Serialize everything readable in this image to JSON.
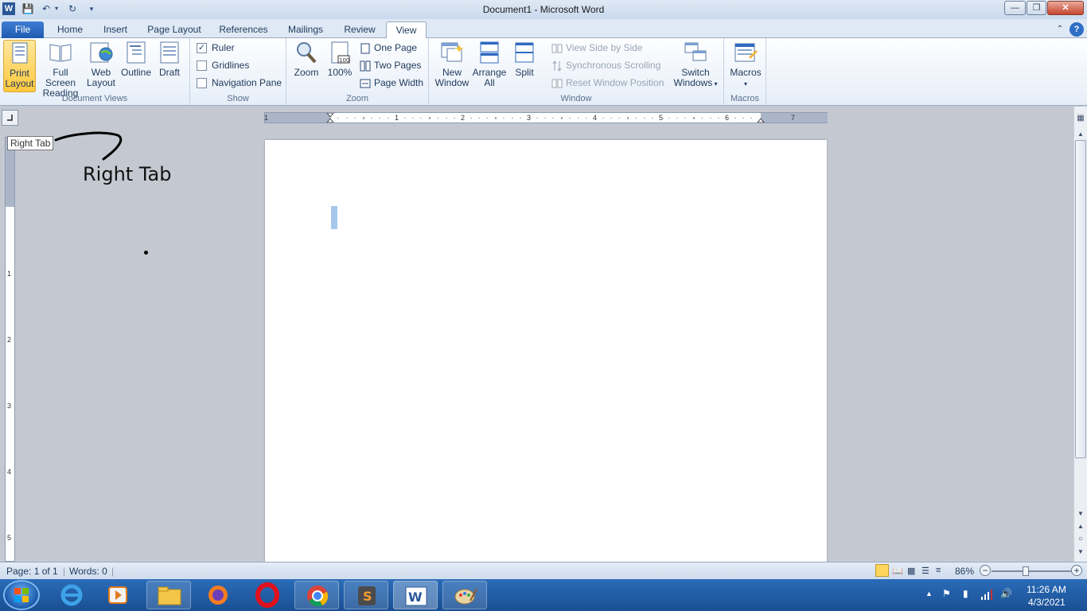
{
  "window": {
    "title": "Document1 - Microsoft Word"
  },
  "tabs": [
    "File",
    "Home",
    "Insert",
    "Page Layout",
    "References",
    "Mailings",
    "Review",
    "View"
  ],
  "ribbon": {
    "document_views": {
      "label": "Document Views",
      "print_layout": [
        "Print",
        "Layout"
      ],
      "full_screen_reading": [
        "Full Screen",
        "Reading"
      ],
      "web_layout": [
        "Web",
        "Layout"
      ],
      "outline": "Outline",
      "draft": "Draft"
    },
    "show": {
      "label": "Show",
      "ruler": "Ruler",
      "ruler_checked": true,
      "gridlines": "Gridlines",
      "navigation_pane": "Navigation Pane"
    },
    "zoom": {
      "label": "Zoom",
      "zoom": "Zoom",
      "hundred": "100%",
      "one_page": "One Page",
      "two_pages": "Two Pages",
      "page_width": "Page Width"
    },
    "window": {
      "label": "Window",
      "new_window": [
        "New",
        "Window"
      ],
      "arrange_all": [
        "Arrange",
        "All"
      ],
      "split": "Split",
      "view_side_by_side": "View Side by Side",
      "synchronous_scrolling": "Synchronous Scrolling",
      "reset_window_position": "Reset Window Position",
      "switch_windows": [
        "Switch",
        "Windows"
      ]
    },
    "macros": {
      "label": "Macros",
      "macros": "Macros"
    }
  },
  "ruler": {
    "numbers": [
      "1",
      "1",
      "2",
      "3",
      "4",
      "5",
      "6",
      "7"
    ],
    "vertical_numbers": [
      "1",
      "2",
      "3",
      "4",
      "5"
    ]
  },
  "tooltip": "Right Tab",
  "annotation": "Right Tab",
  "status": {
    "page": "Page: 1 of 1",
    "words": "Words: 0",
    "zoom": "86%"
  },
  "clock": {
    "time": "11:26 AM",
    "date": "4/3/2021"
  }
}
